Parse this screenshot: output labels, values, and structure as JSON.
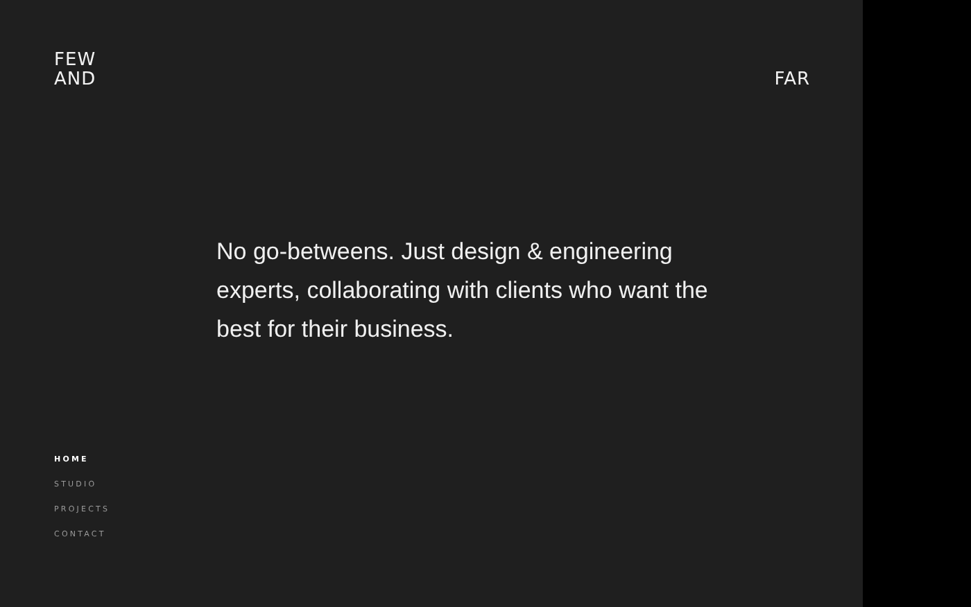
{
  "logo": {
    "lines": [
      "FEW",
      "AND"
    ],
    "end": "FAR"
  },
  "intro": "No go-betweens. Just design & engineering experts, collaborating with clients who want the best for their business.",
  "nav": [
    {
      "label": "HOME",
      "selected": true
    },
    {
      "label": "STUDIO",
      "selected": false
    },
    {
      "label": "PROJECTS",
      "selected": false
    },
    {
      "label": "CONTACT",
      "selected": false
    }
  ]
}
